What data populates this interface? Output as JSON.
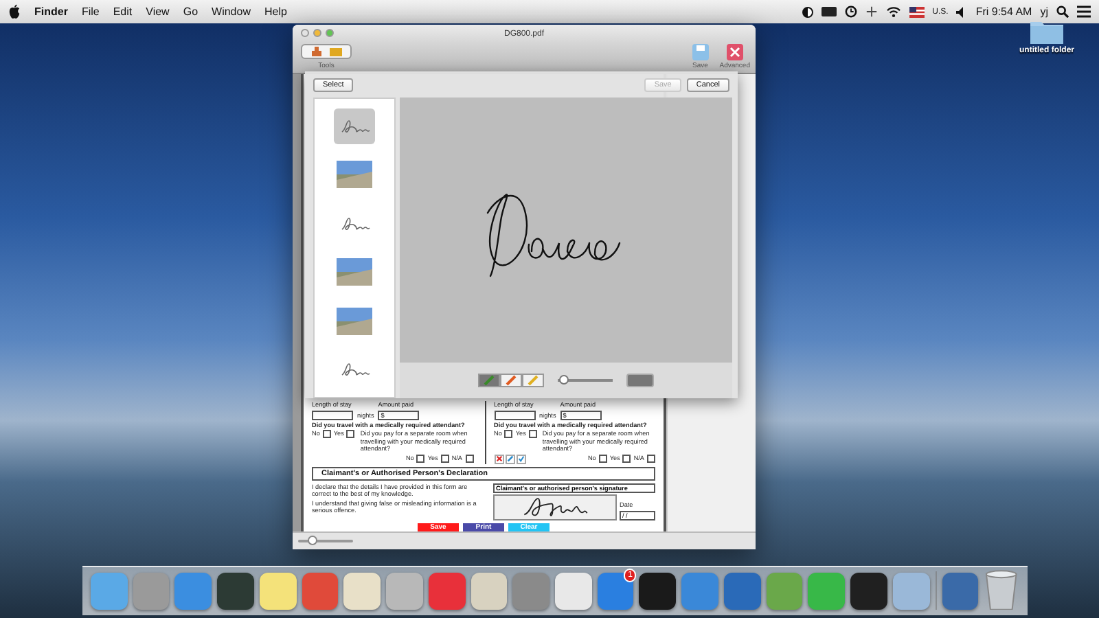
{
  "menu_bar": {
    "app": "Finder",
    "items": [
      "File",
      "Edit",
      "View",
      "Go",
      "Window",
      "Help"
    ],
    "input_source": "U.S.",
    "clock": "Fri 9:54 AM",
    "user": "yj"
  },
  "desktop": {
    "folder_label": "untitled folder"
  },
  "window": {
    "title": "DG800.pdf",
    "toolbar": {
      "tools_label": "Tools",
      "actions": [
        "Save",
        "Advanced"
      ]
    },
    "zoom": {
      "level": 0.25
    }
  },
  "signature_sheet": {
    "select_button": "Select",
    "save_button": {
      "label": "Save",
      "disabled": true
    },
    "cancel_button": "Cancel",
    "thumbnails": [
      {
        "kind": "signature",
        "selected": true
      },
      {
        "kind": "photo",
        "selected": false
      },
      {
        "kind": "signature",
        "selected": false
      },
      {
        "kind": "photo",
        "selected": false
      },
      {
        "kind": "photo",
        "selected": false
      },
      {
        "kind": "signature",
        "selected": false
      }
    ],
    "pen_tools": [
      {
        "selected": true
      },
      {
        "selected": false
      },
      {
        "selected": false
      }
    ],
    "stroke": {
      "level": 0.1
    }
  },
  "form": {
    "columns": [
      {
        "stay_label": "Length of stay",
        "nights_label": "nights",
        "amount_label": "Amount paid",
        "currency": "$",
        "attendant_question": "Did you travel with a medically required attendant?",
        "attendant_options": [
          {
            "label": "No",
            "checked": false
          },
          {
            "label": "Yes",
            "checked": false
          }
        ],
        "room_question": "Did you pay for a separate room when travelling with your medically required attendant?",
        "room_options": [
          {
            "label": "No",
            "checked": false
          },
          {
            "label": "Yes",
            "checked": false
          },
          {
            "label": "N/A",
            "checked": false
          }
        ]
      },
      {
        "stay_label": "Length of stay",
        "nights_label": "nights",
        "amount_label": "Amount paid",
        "currency": "$",
        "attendant_question": "Did you travel with a medically required attendant?",
        "attendant_options": [
          {
            "label": "No",
            "checked": false
          },
          {
            "label": "Yes",
            "checked": false
          }
        ],
        "room_question": "Did you pay for a separate room when travelling with your medically required attendant?",
        "room_options": [
          {
            "label": "No",
            "checked": false
          },
          {
            "label": "Yes",
            "checked": false
          },
          {
            "label": "N/A",
            "checked": false
          }
        ]
      }
    ],
    "declaration": {
      "title": "Claimant's or Authorised Person's Declaration",
      "statements": [
        "I declare that the details I have provided in this form are correct to the best of my knowledge.",
        "I understand that giving false or misleading information is a serious offence."
      ],
      "signature_label": "Claimant's or authorised person's signature",
      "date_label": "Date",
      "date_value": "/ /"
    },
    "buttons": [
      {
        "label": "Save",
        "color": "#ff1a1a"
      },
      {
        "label": "Print",
        "color": "#4a4aa8"
      },
      {
        "label": "Clear",
        "color": "#22c4f4"
      }
    ]
  },
  "dock": {
    "badge": "1"
  }
}
